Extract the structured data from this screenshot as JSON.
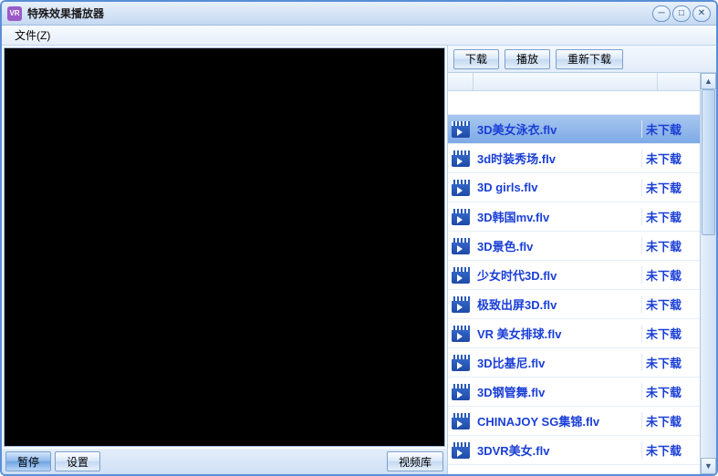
{
  "window": {
    "app_icon_text": "VR",
    "title": "特殊效果播放器"
  },
  "menu": {
    "file": "文件(Z)"
  },
  "left": {
    "pause": "暂停",
    "settings": "设置",
    "library": "视频库"
  },
  "right_toolbar": {
    "download": "下载",
    "play": "播放",
    "redownload": "重新下载"
  },
  "list": {
    "selected_index": 0,
    "items": [
      {
        "name": "3D美女泳衣.flv",
        "status": "未下载"
      },
      {
        "name": "3d时装秀场.flv",
        "status": "未下载"
      },
      {
        "name": "3D girls.flv",
        "status": "未下载"
      },
      {
        "name": "3D韩国mv.flv",
        "status": "未下载"
      },
      {
        "name": "3D景色.flv",
        "status": "未下载"
      },
      {
        "name": "少女时代3D.flv",
        "status": "未下载"
      },
      {
        "name": "极致出屏3D.flv",
        "status": "未下载"
      },
      {
        "name": "VR 美女排球.flv",
        "status": "未下载"
      },
      {
        "name": "3D比基尼.flv",
        "status": "未下载"
      },
      {
        "name": "3D钢管舞.flv",
        "status": "未下载"
      },
      {
        "name": "CHINAJOY SG集锦.flv",
        "status": "未下载"
      },
      {
        "name": "3DVR美女.flv",
        "status": "未下载"
      }
    ]
  }
}
